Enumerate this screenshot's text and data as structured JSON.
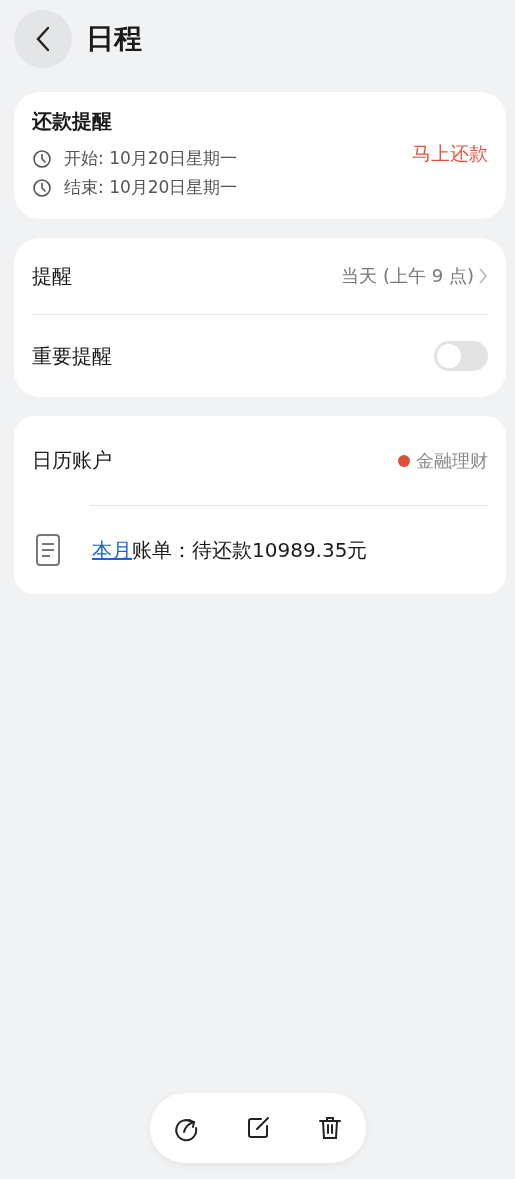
{
  "header": {
    "title": "日程"
  },
  "event": {
    "title": "还款提醒",
    "times": [
      {
        "label": "开始: 10月20日星期一"
      },
      {
        "label": "结束: 10月20日星期一"
      }
    ],
    "action": "马上还款"
  },
  "settings": [
    {
      "kind": "link",
      "label": "提醒",
      "value": "当天 (上午 9 点)"
    },
    {
      "kind": "switch",
      "label": "重要提醒",
      "on": false
    }
  ],
  "account": {
    "label": "日历账户",
    "calendar": "金融理财",
    "color": "#d9533a",
    "note": {
      "link": "本月",
      "text": "账单：待还款10989.35元"
    }
  },
  "toolbar": [
    {
      "kind": "share"
    },
    {
      "kind": "edit"
    },
    {
      "kind": "delete"
    }
  ]
}
